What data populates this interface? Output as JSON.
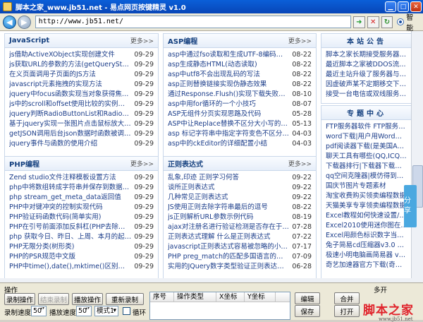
{
  "window": {
    "title": "脚本之家_www.jb51.net - 易点网页按键精灵 v1.0"
  },
  "toolbar": {
    "url": "http://www.jb51.net/",
    "smart_label": "智能"
  },
  "panels": {
    "js": {
      "title": "JavaScript",
      "more": "更多>>",
      "items": [
        {
          "t": "js借助ActiveXObject实现创建文件",
          "d": "09-29"
        },
        {
          "t": "js获取URL的参数的方法(getQueryString)示",
          "d": "09-29"
        },
        {
          "t": "在义页面调用子页面的JS方法",
          "d": "09-29"
        },
        {
          "t": "javascript元素拖拽的实现方法",
          "d": "09-29"
        },
        {
          "t": "jquery中focus函数实现当对象获得焦点后",
          "d": "09-29"
        },
        {
          "t": "js中的scroll和offset使用比较的实例与分",
          "d": "09-29"
        },
        {
          "t": "jquery判断RadioButtonList和RadioButton",
          "d": "09-29"
        },
        {
          "t": "基于jquery实现一张图片点击鼠标放大再点",
          "d": "09-29"
        },
        {
          "t": "getJSON调用后台json数据时函数被调用两次",
          "d": "09-29"
        },
        {
          "t": "jquery事件与函数的使用介绍",
          "d": "09-29"
        }
      ]
    },
    "asp": {
      "title": "ASP编程",
      "more": "更多>>",
      "items": [
        {
          "t": "asp中通过fso读取和生成UTF-8编码的bt",
          "d": "08-22"
        },
        {
          "t": "asp生成静态HTML(动态读取)",
          "d": "08-22"
        },
        {
          "t": "asp中utf8不会出现乱码的写法",
          "d": "08-22"
        },
        {
          "t": "asp正则替换链接实现伪静态效果",
          "d": "08-22"
        },
        {
          "t": "通过Response.Flush()实现下载失败的解决",
          "d": "08-10"
        },
        {
          "t": "asp中用for循环的一个小技巧",
          "d": "08-07"
        },
        {
          "t": "ASP无组件分页实现思路及代码",
          "d": "05-28"
        },
        {
          "t": "ASP中让Replace替换不区分大小写的方法",
          "d": "05-13"
        },
        {
          "t": "asp 标记字符串中指定字符变色不区分大小",
          "d": "04-03"
        },
        {
          "t": "asp中的ckEditor的详细配置小结",
          "d": "04-03"
        }
      ]
    },
    "php": {
      "title": "PHP编程",
      "more": "更多>>",
      "items": [
        {
          "t": "Zend studio文件注释模板设置方法",
          "d": "09-29"
        },
        {
          "t": "php中将数组转成字符串并保存到数据库中的",
          "d": "09-29"
        },
        {
          "t": "php stream_get_meta_data返回值",
          "d": "09-29"
        },
        {
          "t": "PHP中对键冲突的控制实现代码",
          "d": "09-29"
        },
        {
          "t": "PHP验证码函数代码(简单实用)",
          "d": "09-29"
        },
        {
          "t": "PHP在引号前面添加反斜杠(PHP去除反斜杠)",
          "d": "09-29"
        },
        {
          "t": "php 获取今日、昨日、上周、本月的起始时",
          "d": "09-29"
        },
        {
          "t": "PHP无限分类(树形类)",
          "d": "09-29"
        },
        {
          "t": "PHP的PSR规范中文版",
          "d": "09-29"
        },
        {
          "t": "PHP中time(),date(),mktime()区别介绍",
          "d": "09-29"
        }
      ]
    },
    "regex": {
      "title": "正则表达式",
      "more": "更多>>",
      "items": [
        {
          "t": "乱象,印迹 正则学习何答",
          "d": "09-22"
        },
        {
          "t": "谈所正则表达式",
          "d": "09-22"
        },
        {
          "t": "几种常见正则表达式",
          "d": "09-22"
        },
        {
          "t": "JS使用正则去除字符串最后的逗号",
          "d": "08-22"
        },
        {
          "t": "js正则解析URL参数示例代码",
          "d": "08-19"
        },
        {
          "t": "ajax对注册名进行验证检测是否存在于数据",
          "d": "07-28"
        },
        {
          "t": "正则表达式理解 什么是正则表达式",
          "d": "07-22"
        },
        {
          "t": "javascript正则表达式容易被忽略的小问题",
          "d": "07-17"
        },
        {
          "t": "PHP preg_match的匹配多国语言的技巧",
          "d": "07-09"
        },
        {
          "t": "实用的JQuery数字类型验证正则表达式整理",
          "d": "06-28"
        }
      ]
    },
    "notice": {
      "title": "本站公告",
      "items": [
        "脚本之家长期接受服务器赞助",
        "最近脚本之家被DDOS流量攻击",
        "最近主站升级了服务器与带宽",
        "因虚破声某不定期移交下载地址",
        "接受一台电信或双线服务器赞助"
      ]
    },
    "topics": {
      "title": "专题中心",
      "items": [
        "FTP服务器软件 FTP服务器 免费FTP",
        "word下载|用户用Word软件编辑文档",
        "pdf阅读器下载(是美国Adobe公司开",
        "聊天工具有哪些(QQ,ICQ,Skype,AOL",
        "下载器排行|下载器下载专用程序的下",
        "qq空间克隆器|模仿得到别人漂亮的空",
        "国庆节图片专题素材",
        "淘宝收费购买领卖编程数据",
        "天猫美享专享领卖编程数据",
        "Excel教程如何快速设置/清除条件格式",
        "Excel2010使用迷你图在单元格中分析",
        "Excel用颜色标识数字当数字发生变化",
        "兔子简易cd压缩器v3.0 中文免费",
        "极速小明电脑画简易器 v3.08 官",
        "奇艺加速器官方下载(奇异加速器)"
      ]
    }
  },
  "share": "分享",
  "bottom": {
    "group_label": "操作",
    "record": "录制操作",
    "end_record": "结束录制",
    "play": "播放操作",
    "rerecord": "重新录制",
    "record_speed_label": "录制速度",
    "record_speed": "50",
    "play_speed_label": "播放速度",
    "play_speed": "50",
    "mode": "模式1",
    "loop_label": "循环",
    "cols": [
      "序号",
      "操作类型",
      "X坐标",
      "Y坐标"
    ],
    "edit": "编辑",
    "merge": "合并",
    "save": "保存",
    "open": "打开",
    "multi_open": "多开"
  },
  "watermark": {
    "main": "脚本之家",
    "sub": "www.jb51.net"
  }
}
